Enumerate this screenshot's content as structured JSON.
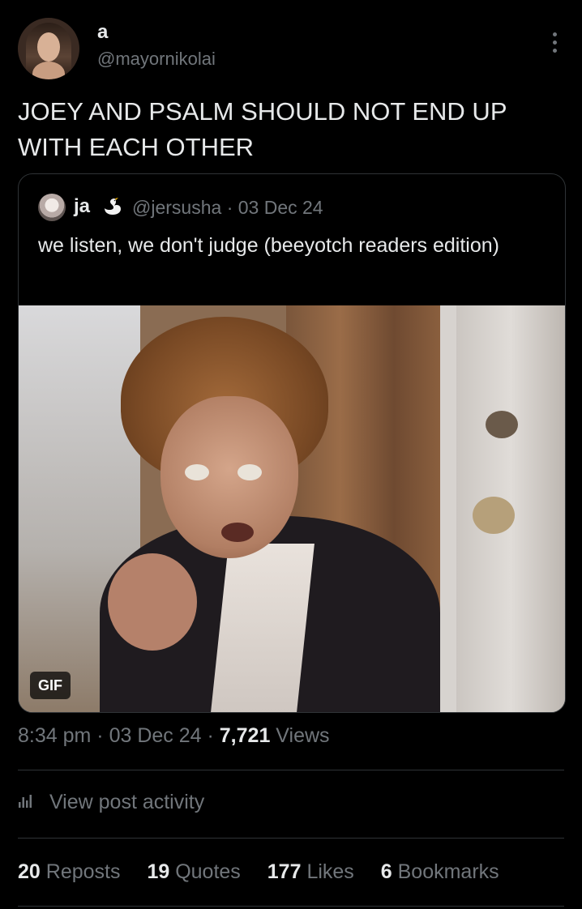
{
  "author": {
    "name": "a",
    "handle": "@mayornikolai"
  },
  "tweet_text": "JOEY AND PSALM SHOULD NOT END UP WITH EACH OTHER",
  "quote": {
    "name": "ja",
    "emoji": "swan",
    "handle": "@jersusha",
    "separator": "·",
    "date": "03 Dec 24",
    "text": "we listen, we don't judge (beeyotch readers edition)",
    "media_badge": "GIF"
  },
  "timeline": {
    "time": "8:34 pm",
    "sep1": "·",
    "date": "03 Dec 24",
    "sep2": "·",
    "views_count": "7,721",
    "views_label": "Views"
  },
  "activity": {
    "label": "View post activity",
    "icon": "bar-chart-icon"
  },
  "stats": {
    "reposts_count": "20",
    "reposts_label": "Reposts",
    "quotes_count": "19",
    "quotes_label": "Quotes",
    "likes_count": "177",
    "likes_label": "Likes",
    "bookmarks_count": "6",
    "bookmarks_label": "Bookmarks"
  },
  "colors": {
    "background": "#000000",
    "text": "#e7e9ea",
    "secondary": "#71767b",
    "border": "#2f3336"
  }
}
